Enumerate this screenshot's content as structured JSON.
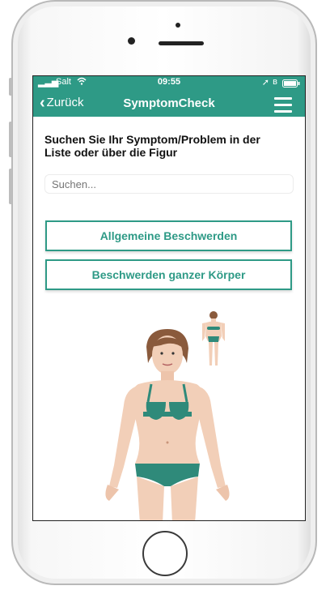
{
  "status": {
    "carrier": "Salt",
    "time": "09:55"
  },
  "nav": {
    "back_label": "Zurück",
    "title": "SymptomCheck"
  },
  "main": {
    "instruction": "Suchen Sie Ihr Symptom/Problem in der Liste oder über die Figur",
    "search_placeholder": "Suchen...",
    "buttons": [
      "Allgemeine Beschwerden",
      "Beschwerden ganzer Körper"
    ]
  },
  "colors": {
    "accent": "#2e9a86"
  },
  "icons": {
    "back": "chevron-left-icon",
    "menu": "hamburger-menu-icon"
  }
}
